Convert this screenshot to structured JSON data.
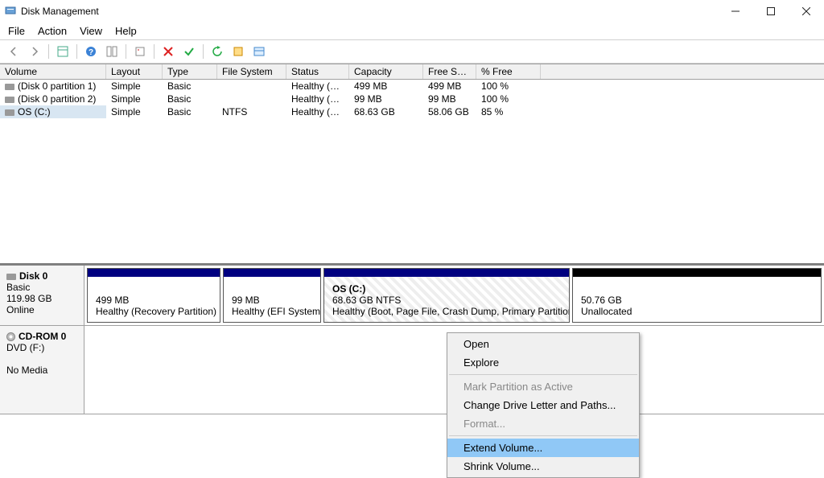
{
  "window": {
    "title": "Disk Management"
  },
  "menu": {
    "file": "File",
    "action": "Action",
    "view": "View",
    "help": "Help"
  },
  "columns": {
    "volume": "Volume",
    "layout": "Layout",
    "type": "Type",
    "fs": "File System",
    "status": "Status",
    "capacity": "Capacity",
    "free": "Free Spa...",
    "pct": "% Free"
  },
  "volumes": [
    {
      "name": "(Disk 0 partition 1)",
      "layout": "Simple",
      "type": "Basic",
      "fs": "",
      "status": "Healthy (R...",
      "capacity": "499 MB",
      "free": "499 MB",
      "pct": "100 %"
    },
    {
      "name": "(Disk 0 partition 2)",
      "layout": "Simple",
      "type": "Basic",
      "fs": "",
      "status": "Healthy (E...",
      "capacity": "99 MB",
      "free": "99 MB",
      "pct": "100 %"
    },
    {
      "name": "OS (C:)",
      "layout": "Simple",
      "type": "Basic",
      "fs": "NTFS",
      "status": "Healthy (B...",
      "capacity": "68.63 GB",
      "free": "58.06 GB",
      "pct": "85 %"
    }
  ],
  "disk0": {
    "title": "Disk 0",
    "sub1": "Basic",
    "sub2": "119.98 GB",
    "sub3": "Online",
    "p1a": "499 MB",
    "p1b": "Healthy (Recovery Partition)",
    "p2a": "99 MB",
    "p2b": "Healthy (EFI System P",
    "p3t": "OS  (C:)",
    "p3a": "68.63 GB NTFS",
    "p3b": "Healthy (Boot, Page File, Crash Dump, Primary Partition",
    "p4a": "50.76 GB",
    "p4b": "Unallocated"
  },
  "cdrom": {
    "title": "CD-ROM 0",
    "sub1": "DVD (F:)",
    "sub2": "No Media"
  },
  "ctx": {
    "open": "Open",
    "explore": "Explore",
    "mark": "Mark Partition as Active",
    "letter": "Change Drive Letter and Paths...",
    "format": "Format...",
    "extend": "Extend Volume...",
    "shrink": "Shrink Volume..."
  }
}
